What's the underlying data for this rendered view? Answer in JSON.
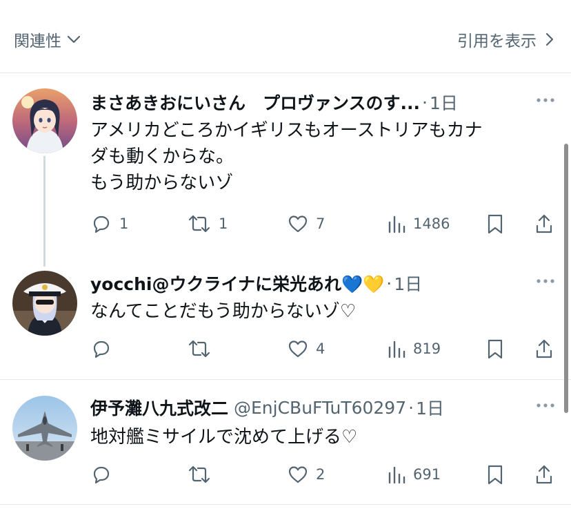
{
  "header": {
    "sort_label": "関連性",
    "quotes_label": "引用を表示"
  },
  "tweets": [
    {
      "name": "まさあきおにいさん　プロヴァンスのす...",
      "handle": "",
      "dot": "·",
      "time": "1日",
      "lines": [
        "アメリカどころかイギリスもオーストリアもカナ",
        "ダも動くからな。",
        "もう助からないゾ"
      ],
      "replies": "1",
      "retweets": "1",
      "likes": "7",
      "views": "1486"
    },
    {
      "name": "yocchi@ウクライナに栄光あれ💙💛",
      "handle": "",
      "dot": "·",
      "time": "1日",
      "lines": [
        "なんてことだもう助からないゾ♡"
      ],
      "replies": "",
      "retweets": "",
      "likes": "4",
      "views": "819"
    },
    {
      "name": "伊予灘八九式改二",
      "handle": "@EnjCBuFTuT60297",
      "dot": "·",
      "time": "1日",
      "lines": [
        "地対艦ミサイルで沈めて上げる♡"
      ],
      "replies": "",
      "retweets": "",
      "likes": "2",
      "views": "691"
    }
  ],
  "icons": {
    "reply": "reply-icon",
    "retweet": "retweet-icon",
    "like": "heart-icon",
    "views": "views-icon",
    "bookmark": "bookmark-icon",
    "share": "share-icon",
    "more": "more-icon"
  },
  "colors": {
    "text": "#0f1419",
    "secondary": "#536471",
    "divider": "#e6e9ec"
  }
}
